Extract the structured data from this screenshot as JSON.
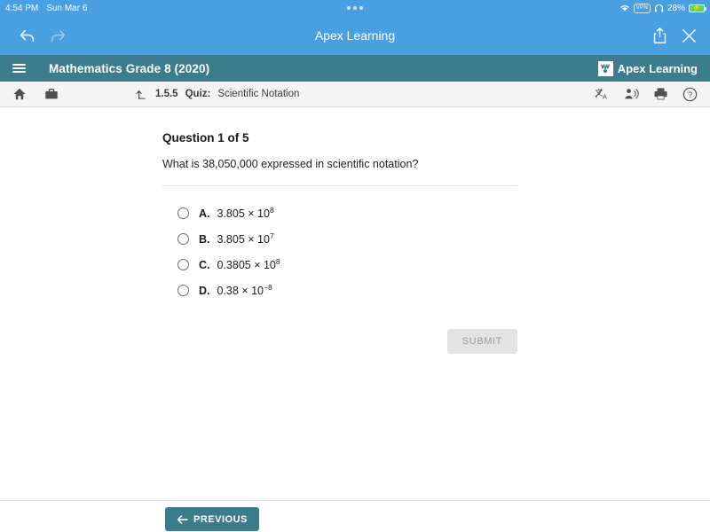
{
  "status_bar": {
    "time": "4:54 PM",
    "date": "Sun Mar 6",
    "vpn_label": "VPN",
    "battery_percent": "28%",
    "icons": [
      "wifi-icon",
      "vpn-badge",
      "headphones-icon",
      "battery-charging-icon"
    ]
  },
  "browser_bar": {
    "title": "Apex Learning",
    "back_icon": "back-arrow-icon",
    "forward_icon": "forward-arrow-icon",
    "share_icon": "share-icon",
    "close_icon": "close-icon"
  },
  "course_bar": {
    "menu_icon": "hamburger-menu-icon",
    "course_title": "Mathematics Grade 8 (2020)",
    "brand_name": "Apex Learning",
    "brand_mark_icon": "apex-learning-logo-icon",
    "background_color": "#3c7c8c"
  },
  "tool_bar": {
    "home_icon": "home-icon",
    "briefcase_icon": "briefcase-icon",
    "level_up_icon": "level-up-arrow-icon",
    "breadcrumb_code": "1.5.5",
    "breadcrumb_kind": "Quiz:",
    "breadcrumb_name": "Scientific Notation",
    "translate_icon": "translate-icon",
    "read-aloud_icon": "read-aloud-icon",
    "print_icon": "print-icon",
    "help_icon": "help-icon"
  },
  "question": {
    "heading": "Question 1 of 5",
    "prompt": "What is 38,050,000 expressed in scientific notation?",
    "choices": [
      {
        "letter": "A.",
        "mantissa": "3.805 × 10",
        "exponent": "8"
      },
      {
        "letter": "B.",
        "mantissa": "3.805 × 10",
        "exponent": "7"
      },
      {
        "letter": "C.",
        "mantissa": "0.3805 × 10",
        "exponent": "8"
      },
      {
        "letter": "D.",
        "mantissa": "0.38 × 10",
        "exponent": "−8"
      }
    ],
    "submit_label": "SUBMIT",
    "submit_enabled": false
  },
  "bottom_bar": {
    "previous_label": "PREVIOUS",
    "previous_icon": "left-arrow-icon",
    "previous_color": "#3c7c8c"
  }
}
